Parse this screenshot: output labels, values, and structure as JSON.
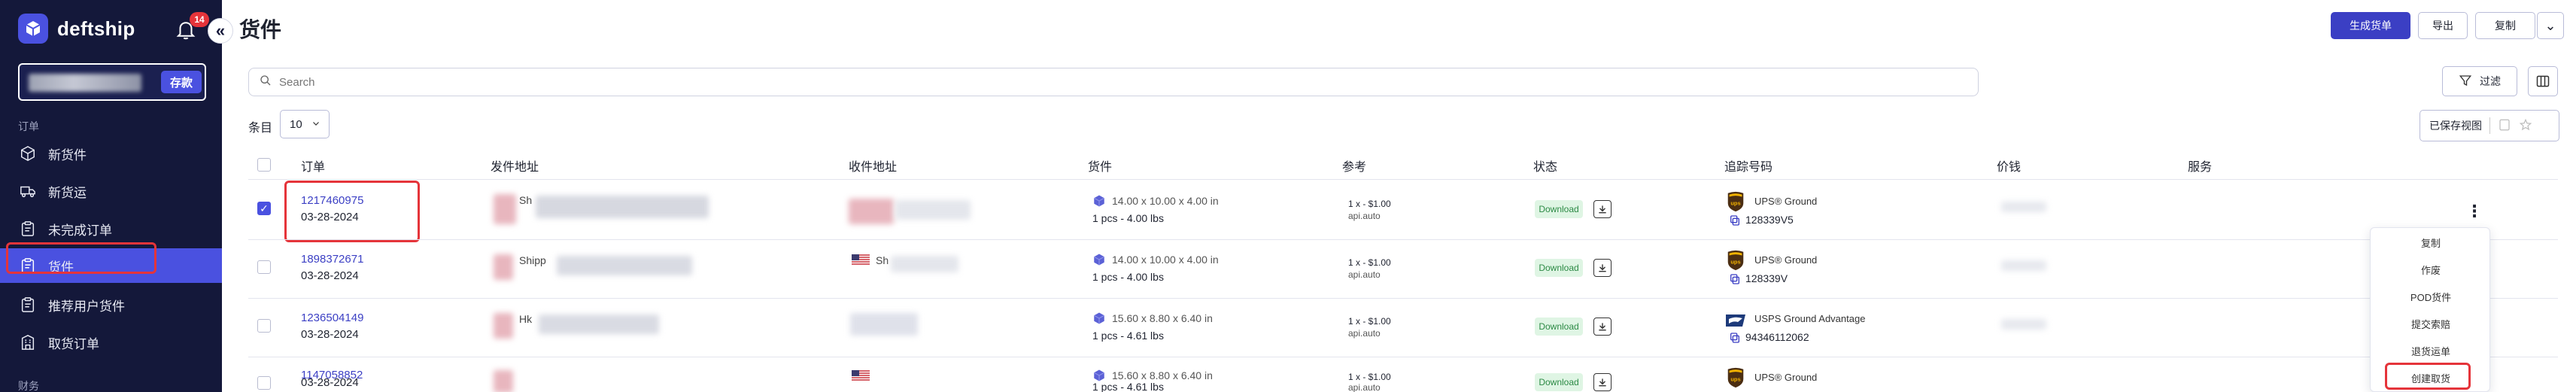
{
  "sidebar": {
    "logo_text": "deftship",
    "notification_count": "14",
    "collapse_glyph": "«",
    "topup_label": "存款",
    "section_orders": "订单",
    "section_finance": "财务",
    "items": [
      {
        "label": "新货件",
        "icon": "cube-icon"
      },
      {
        "label": "新货运",
        "icon": "truck-icon"
      },
      {
        "label": "未完成订单",
        "icon": "clipboard-icon"
      },
      {
        "label": "货件",
        "icon": "clipboard-icon",
        "active": true
      },
      {
        "label": "推荐用户货件",
        "icon": "clipboard-icon"
      },
      {
        "label": "取货订单",
        "icon": "building-icon"
      }
    ]
  },
  "header": {
    "title": "货件",
    "create_label": "生成货单",
    "export_label": "导出",
    "copy_label": "复制",
    "more_glyph": "⌄"
  },
  "search": {
    "placeholder": "Search"
  },
  "toolbar": {
    "filter_label": "过滤",
    "saved_views_label": "已保存视图",
    "per_page_label": "条目",
    "per_page_value": "10"
  },
  "table": {
    "columns": [
      "订单",
      "发件地址",
      "收件地址",
      "货件",
      "参考",
      "状态",
      "追踪号码",
      "价钱",
      "服务"
    ],
    "rows": [
      {
        "order_id": "1217460975",
        "date": "03-28-2024",
        "checked": true,
        "sender_text": "Sh",
        "receiver_text": "",
        "dims": "14.00 x 10.00 x 4.00 in",
        "qty": "1 pcs - 4.00 lbs",
        "ref1": "1 x - $1.00",
        "ref2": "api.auto",
        "status": "Download",
        "carrier": "ups",
        "service": "UPS® Ground",
        "tracking": "128339V5"
      },
      {
        "order_id": "1898372671",
        "date": "03-28-2024",
        "checked": false,
        "sender_text": "Shipp",
        "receiver_text": "Sh",
        "dims": "14.00 x 10.00 x 4.00 in",
        "qty": "1 pcs - 4.00 lbs",
        "ref1": "1 x - $1.00",
        "ref2": "api.auto",
        "status": "Download",
        "carrier": "ups",
        "service": "UPS® Ground",
        "tracking": "128339V"
      },
      {
        "order_id": "1236504149",
        "date": "03-28-2024",
        "checked": false,
        "sender_text": "Hk",
        "receiver_text": "",
        "dims": "15.60 x 8.80 x 6.40 in",
        "qty": "1 pcs - 4.61 lbs",
        "ref1": "1 x - $1.00",
        "ref2": "api.auto",
        "status": "Download",
        "carrier": "usps",
        "service": "USPS Ground Advantage",
        "tracking": "94346112062"
      },
      {
        "order_id": "1147058852",
        "date": "03-28-2024",
        "checked": false,
        "sender_text": "",
        "receiver_text": "",
        "dims": "15.60 x 8.80 x 6.40 in",
        "qty": "1 pcs - 4.61 lbs",
        "ref1": "1 x - $1.00",
        "ref2": "api.auto",
        "status": "Download",
        "carrier": "ups",
        "service": "UPS® Ground",
        "tracking": ""
      }
    ]
  },
  "row_menu": {
    "items": [
      "复制",
      "作废",
      "POD货件",
      "提交索赔",
      "退货运单",
      "创建取货"
    ]
  },
  "colors": {
    "sidebar_bg": "#14183a",
    "accent": "#4a51e0",
    "primary_button": "#3b3fc4",
    "highlight_box": "#e5343a",
    "download_badge_bg": "#dff5e4",
    "download_badge_text": "#2c8a45",
    "ups_brown": "#4b2e12",
    "ups_gold": "#f5b400",
    "usps_blue": "#1d3a7a"
  }
}
